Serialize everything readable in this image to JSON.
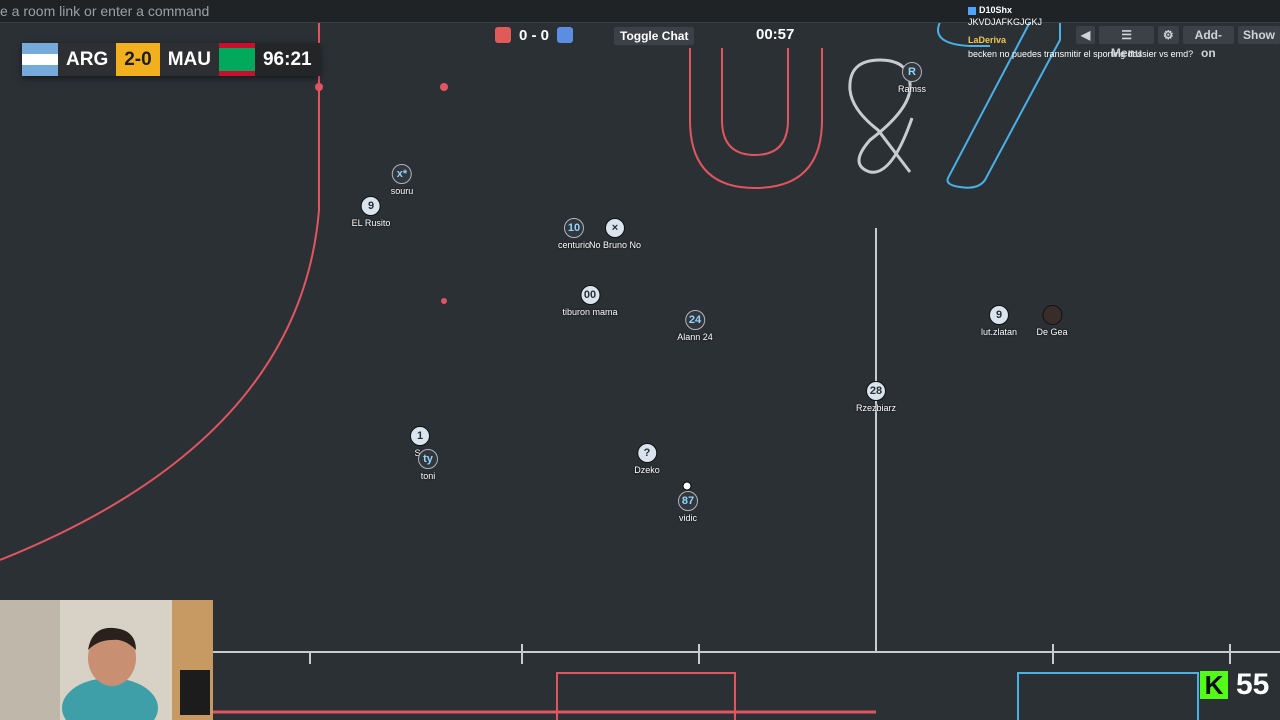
{
  "command_bar": {
    "placeholder": "e a room link or enter a command"
  },
  "scoreboard": {
    "home": "ARG",
    "away": "MAU",
    "score": "2-0",
    "time": "96:21"
  },
  "top": {
    "score": "0 - 0",
    "toggle_chat": "Toggle Chat",
    "timer": "00:57",
    "red_color": "#e05a5a",
    "blue_color": "#5b8de0"
  },
  "menu": {
    "back": "◀",
    "menu": "☰ Menu",
    "settings": "⚙",
    "addon": "Add-on",
    "show": "Show"
  },
  "chat": [
    {
      "user": "D10Shx",
      "text": ""
    },
    {
      "user": "",
      "text": "JKVDJAFKGJGKJ"
    },
    {
      "user": "LaDeriva",
      "text": ""
    },
    {
      "user": "",
      "text": "becken no puedes transmitir el sporting dossier vs emd?"
    }
  ],
  "players": [
    {
      "avatar": "x*",
      "name": "souru"
    },
    {
      "avatar": "9",
      "name": "EL Rusito"
    },
    {
      "avatar": "10",
      "name": "centurio"
    },
    {
      "avatar": "×",
      "name": "No Bruno No"
    },
    {
      "avatar": "00",
      "name": "tiburon mama"
    },
    {
      "avatar": "24",
      "name": "Alann 24"
    },
    {
      "avatar": "R",
      "name": "Ramss"
    },
    {
      "avatar": "9",
      "name": "lut.zlatan"
    },
    {
      "avatar": "",
      "name": "De Gea"
    },
    {
      "avatar": "28",
      "name": "Rzezbiarz"
    },
    {
      "avatar": "1",
      "name": "Sa"
    },
    {
      "avatar": "ty",
      "name": "toni"
    },
    {
      "avatar": "?",
      "name": "Dzeko"
    },
    {
      "avatar": "87",
      "name": "vidic"
    }
  ],
  "stream": {
    "viewers": "55",
    "logo": "K"
  }
}
